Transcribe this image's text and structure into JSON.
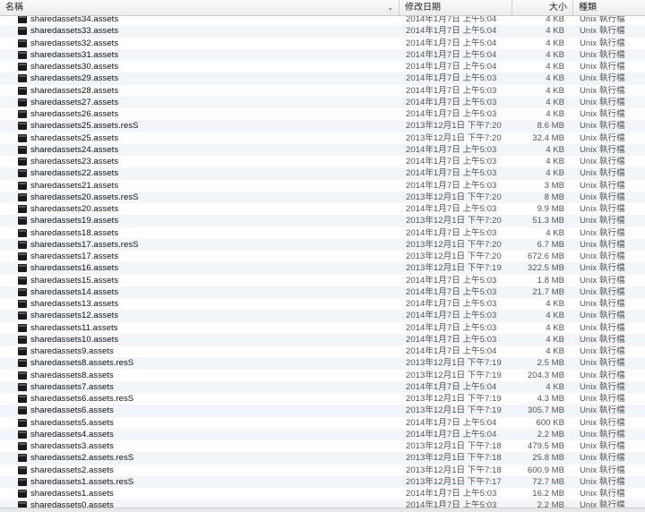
{
  "header": {
    "name_label": "名稱",
    "date_label": "修改日期",
    "size_label": "大小",
    "kind_label": "種類",
    "sort_glyph": "⌄"
  },
  "files": [
    {
      "name": "sharedassets34.assets",
      "date": "2014年1月7日 上午5:04",
      "size": "4 KB",
      "kind": "Unix 執行檔"
    },
    {
      "name": "sharedassets33.assets",
      "date": "2014年1月7日 上午5:04",
      "size": "4 KB",
      "kind": "Unix 執行檔"
    },
    {
      "name": "sharedassets32.assets",
      "date": "2014年1月7日 上午5:04",
      "size": "4 KB",
      "kind": "Unix 執行檔"
    },
    {
      "name": "sharedassets31.assets",
      "date": "2014年1月7日 上午5:04",
      "size": "4 KB",
      "kind": "Unix 執行檔"
    },
    {
      "name": "sharedassets30.assets",
      "date": "2014年1月7日 上午5:04",
      "size": "4 KB",
      "kind": "Unix 執行檔"
    },
    {
      "name": "sharedassets29.assets",
      "date": "2014年1月7日 上午5:03",
      "size": "4 KB",
      "kind": "Unix 執行檔"
    },
    {
      "name": "sharedassets28.assets",
      "date": "2014年1月7日 上午5:03",
      "size": "4 KB",
      "kind": "Unix 執行檔"
    },
    {
      "name": "sharedassets27.assets",
      "date": "2014年1月7日 上午5:03",
      "size": "4 KB",
      "kind": "Unix 執行檔"
    },
    {
      "name": "sharedassets26.assets",
      "date": "2014年1月7日 上午5:03",
      "size": "4 KB",
      "kind": "Unix 執行檔"
    },
    {
      "name": "sharedassets25.assets.resS",
      "date": "2013年12月1日 下午7:20",
      "size": "8.6 MB",
      "kind": "Unix 執行檔"
    },
    {
      "name": "sharedassets25.assets",
      "date": "2013年12月1日 下午7:20",
      "size": "32.4 MB",
      "kind": "Unix 執行檔"
    },
    {
      "name": "sharedassets24.assets",
      "date": "2014年1月7日 上午5:03",
      "size": "4 KB",
      "kind": "Unix 執行檔"
    },
    {
      "name": "sharedassets23.assets",
      "date": "2014年1月7日 上午5:03",
      "size": "4 KB",
      "kind": "Unix 執行檔"
    },
    {
      "name": "sharedassets22.assets",
      "date": "2014年1月7日 上午5:03",
      "size": "4 KB",
      "kind": "Unix 執行檔"
    },
    {
      "name": "sharedassets21.assets",
      "date": "2014年1月7日 上午5:03",
      "size": "3 MB",
      "kind": "Unix 執行檔"
    },
    {
      "name": "sharedassets20.assets.resS",
      "date": "2013年12月1日 下午7:20",
      "size": "8 MB",
      "kind": "Unix 執行檔"
    },
    {
      "name": "sharedassets20.assets",
      "date": "2014年1月7日 上午5:03",
      "size": "9.9 MB",
      "kind": "Unix 執行檔"
    },
    {
      "name": "sharedassets19.assets",
      "date": "2013年12月1日 下午7:20",
      "size": "51.3 MB",
      "kind": "Unix 執行檔"
    },
    {
      "name": "sharedassets18.assets",
      "date": "2014年1月7日 上午5:03",
      "size": "4 KB",
      "kind": "Unix 執行檔"
    },
    {
      "name": "sharedassets17.assets.resS",
      "date": "2013年12月1日 下午7:20",
      "size": "6.7 MB",
      "kind": "Unix 執行檔"
    },
    {
      "name": "sharedassets17.assets",
      "date": "2013年12月1日 下午7:20",
      "size": "672.6 MB",
      "kind": "Unix 執行檔"
    },
    {
      "name": "sharedassets16.assets",
      "date": "2013年12月1日 下午7:19",
      "size": "322.5 MB",
      "kind": "Unix 執行檔"
    },
    {
      "name": "sharedassets15.assets",
      "date": "2014年1月7日 上午5:03",
      "size": "1.8 MB",
      "kind": "Unix 執行檔"
    },
    {
      "name": "sharedassets14.assets",
      "date": "2014年1月7日 上午5:03",
      "size": "21.7 MB",
      "kind": "Unix 執行檔"
    },
    {
      "name": "sharedassets13.assets",
      "date": "2014年1月7日 上午5:03",
      "size": "4 KB",
      "kind": "Unix 執行檔"
    },
    {
      "name": "sharedassets12.assets",
      "date": "2014年1月7日 上午5:03",
      "size": "4 KB",
      "kind": "Unix 執行檔"
    },
    {
      "name": "sharedassets11.assets",
      "date": "2014年1月7日 上午5:03",
      "size": "4 KB",
      "kind": "Unix 執行檔"
    },
    {
      "name": "sharedassets10.assets",
      "date": "2014年1月7日 上午5:03",
      "size": "4 KB",
      "kind": "Unix 執行檔"
    },
    {
      "name": "sharedassets9.assets",
      "date": "2014年1月7日 上午5:04",
      "size": "4 KB",
      "kind": "Unix 執行檔"
    },
    {
      "name": "sharedassets8.assets.resS",
      "date": "2013年12月1日 下午7:19",
      "size": "2.5 MB",
      "kind": "Unix 執行檔"
    },
    {
      "name": "sharedassets8.assets",
      "date": "2013年12月1日 下午7:19",
      "size": "204.3 MB",
      "kind": "Unix 執行檔"
    },
    {
      "name": "sharedassets7.assets",
      "date": "2014年1月7日 上午5:04",
      "size": "4 KB",
      "kind": "Unix 執行檔"
    },
    {
      "name": "sharedassets6.assets.resS",
      "date": "2013年12月1日 下午7:19",
      "size": "4.3 MB",
      "kind": "Unix 執行檔"
    },
    {
      "name": "sharedassets6.assets",
      "date": "2013年12月1日 下午7:19",
      "size": "305.7 MB",
      "kind": "Unix 執行檔"
    },
    {
      "name": "sharedassets5.assets",
      "date": "2014年1月7日 上午5:04",
      "size": "600 KB",
      "kind": "Unix 執行檔"
    },
    {
      "name": "sharedassets4.assets",
      "date": "2014年1月7日 上午5:04",
      "size": "2.2 MB",
      "kind": "Unix 執行檔"
    },
    {
      "name": "sharedassets3.assets",
      "date": "2013年12月1日 下午7:18",
      "size": "479.5 MB",
      "kind": "Unix 執行檔"
    },
    {
      "name": "sharedassets2.assets.resS",
      "date": "2013年12月1日 下午7:18",
      "size": "25.8 MB",
      "kind": "Unix 執行檔"
    },
    {
      "name": "sharedassets2.assets",
      "date": "2013年12月1日 下午7:18",
      "size": "600.9 MB",
      "kind": "Unix 執行檔"
    },
    {
      "name": "sharedassets1.assets.resS",
      "date": "2013年12月1日 下午7:17",
      "size": "72.7 MB",
      "kind": "Unix 執行檔"
    },
    {
      "name": "sharedassets1.assets",
      "date": "2014年1月7日 上午5:03",
      "size": "16.2 MB",
      "kind": "Unix 執行檔"
    },
    {
      "name": "sharedassets0.assets",
      "date": "2014年1月7日 上午5:03",
      "size": "2.2 MB",
      "kind": "Unix 執行檔"
    }
  ],
  "icons": {
    "file": "unix-executable-icon",
    "sort": "chevron-down-icon"
  },
  "colors": {
    "row_alt": "#f2f5fa",
    "header_bg": "#ececec",
    "text_primary": "#111111",
    "text_secondary": "#555555"
  }
}
